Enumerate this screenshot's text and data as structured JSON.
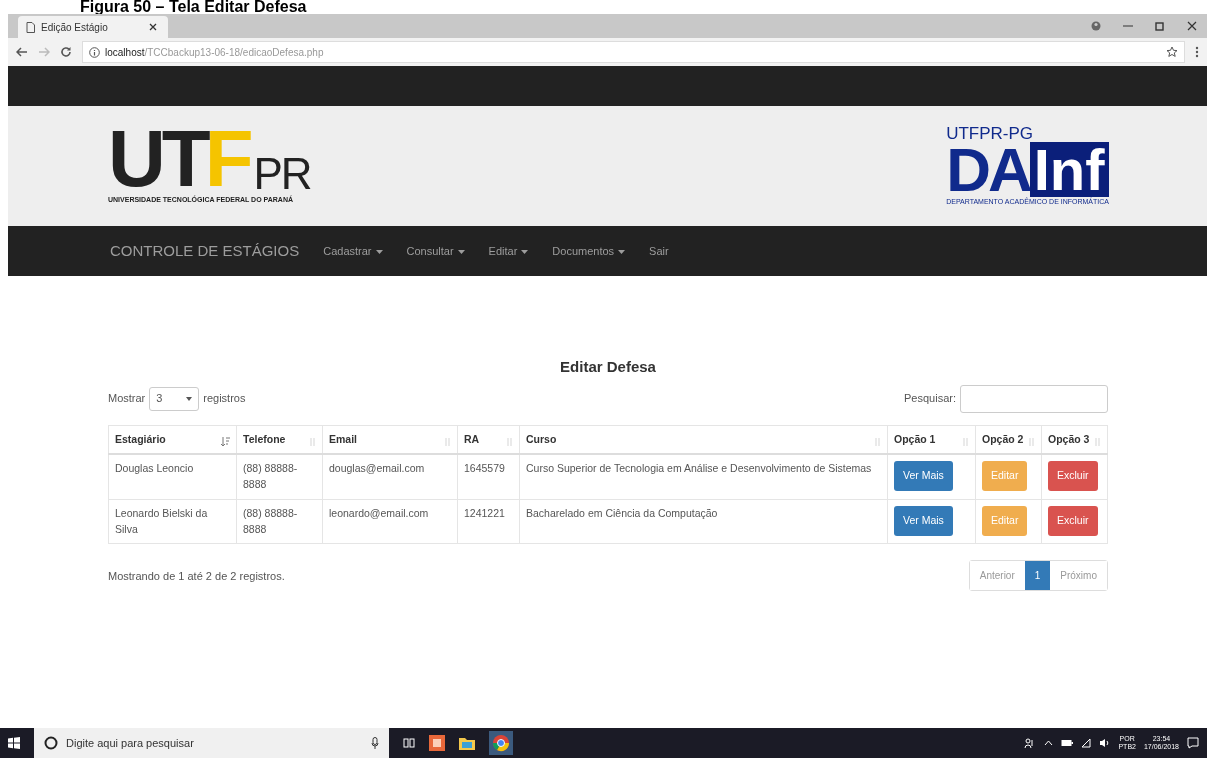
{
  "caption": "Figura 50 – Tela Editar Defesa",
  "browser": {
    "tab_title": "Edição Estágio",
    "url_host": "localhost",
    "url_path": "/TCCbackup13-06-18/edicaoDefesa.php"
  },
  "header": {
    "left_logo": {
      "main": "UT",
      "accent": "F",
      "suffix": "PR",
      "subtitle": "UNIVERSIDADE TECNOLÓGICA FEDERAL DO PARANÁ"
    },
    "right_logo": {
      "top": "UTFPR-PG",
      "main": "DA",
      "boxed": "Inf",
      "subtitle": "DEPARTAMENTO ACADÊMICO DE INFORMÁTICA"
    }
  },
  "navbar": {
    "brand": "CONTROLE DE ESTÁGIOS",
    "items": [
      {
        "label": "Cadastrar",
        "dropdown": true
      },
      {
        "label": "Consultar",
        "dropdown": true
      },
      {
        "label": "Editar",
        "dropdown": true
      },
      {
        "label": "Documentos",
        "dropdown": true
      },
      {
        "label": "Sair",
        "dropdown": false
      }
    ]
  },
  "page_title": "Editar Defesa",
  "length": {
    "label_before": "Mostrar",
    "value": "3",
    "label_after": "registros"
  },
  "search": {
    "label": "Pesquisar:"
  },
  "table": {
    "columns": [
      {
        "label": "Estagiário",
        "sorted": true
      },
      {
        "label": "Telefone",
        "sorted": false
      },
      {
        "label": "Email",
        "sorted": false
      },
      {
        "label": "RA",
        "sorted": false
      },
      {
        "label": "Curso",
        "sorted": false
      },
      {
        "label": "Opção 1",
        "sorted": false
      },
      {
        "label": "Opção 2",
        "sorted": false
      },
      {
        "label": "Opção 3",
        "sorted": false
      }
    ],
    "rows": [
      {
        "cells": [
          "Douglas Leoncio",
          "(88) 88888-8888",
          "douglas@email.com",
          "1645579",
          "Curso Superior de Tecnologia em Análise e Desenvolvimento de Sistemas"
        ],
        "actions": [
          {
            "label": "Ver Mais",
            "kind": "view"
          },
          {
            "label": "Editar",
            "kind": "edit"
          },
          {
            "label": "Excluir",
            "kind": "delete"
          }
        ]
      },
      {
        "cells": [
          "Leonardo Bielski da Silva",
          "(88) 88888-8888",
          "leonardo@email.com",
          "1241221",
          "Bacharelado em Ciência da Computação"
        ],
        "actions": [
          {
            "label": "Ver Mais",
            "kind": "view"
          },
          {
            "label": "Editar",
            "kind": "edit"
          },
          {
            "label": "Excluir",
            "kind": "delete"
          }
        ]
      }
    ]
  },
  "info": "Mostrando de 1 até 2 de 2 registros.",
  "pagination": [
    {
      "label": "Anterior",
      "selected": false,
      "disabled": true
    },
    {
      "label": "1",
      "selected": true,
      "disabled": false
    },
    {
      "label": "Próximo",
      "selected": false,
      "disabled": true
    }
  ],
  "taskbar": {
    "search_placeholder": "Digite aqui para pesquisar",
    "language": "POR",
    "layout": "PTB2",
    "time": "23:54",
    "date": "17/06/2018"
  }
}
